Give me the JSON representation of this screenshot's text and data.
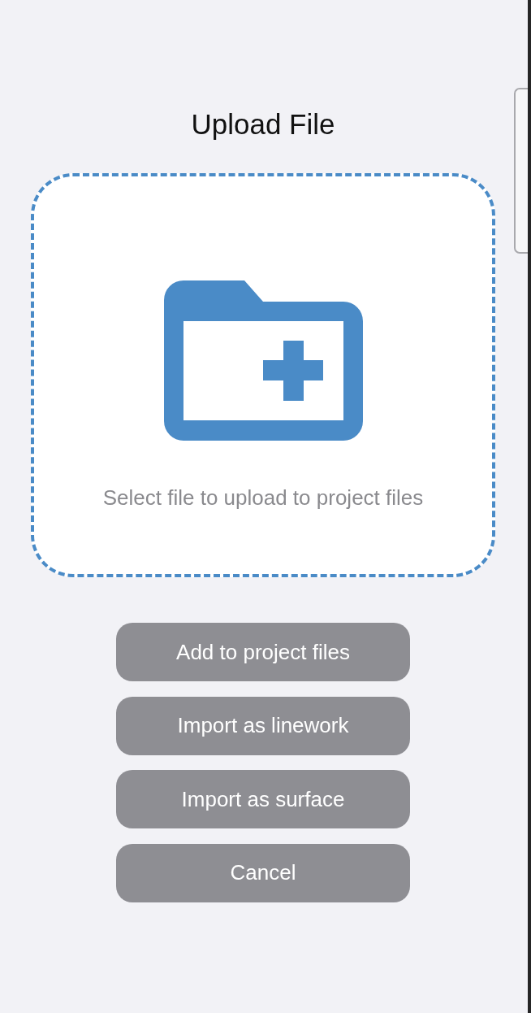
{
  "dialog": {
    "title": "Upload File"
  },
  "drop_zone": {
    "hint": "Select file to upload to project files"
  },
  "buttons": [
    {
      "label": "Add to project files"
    },
    {
      "label": "Import as linework"
    },
    {
      "label": "Import as surface"
    },
    {
      "label": "Cancel"
    }
  ]
}
